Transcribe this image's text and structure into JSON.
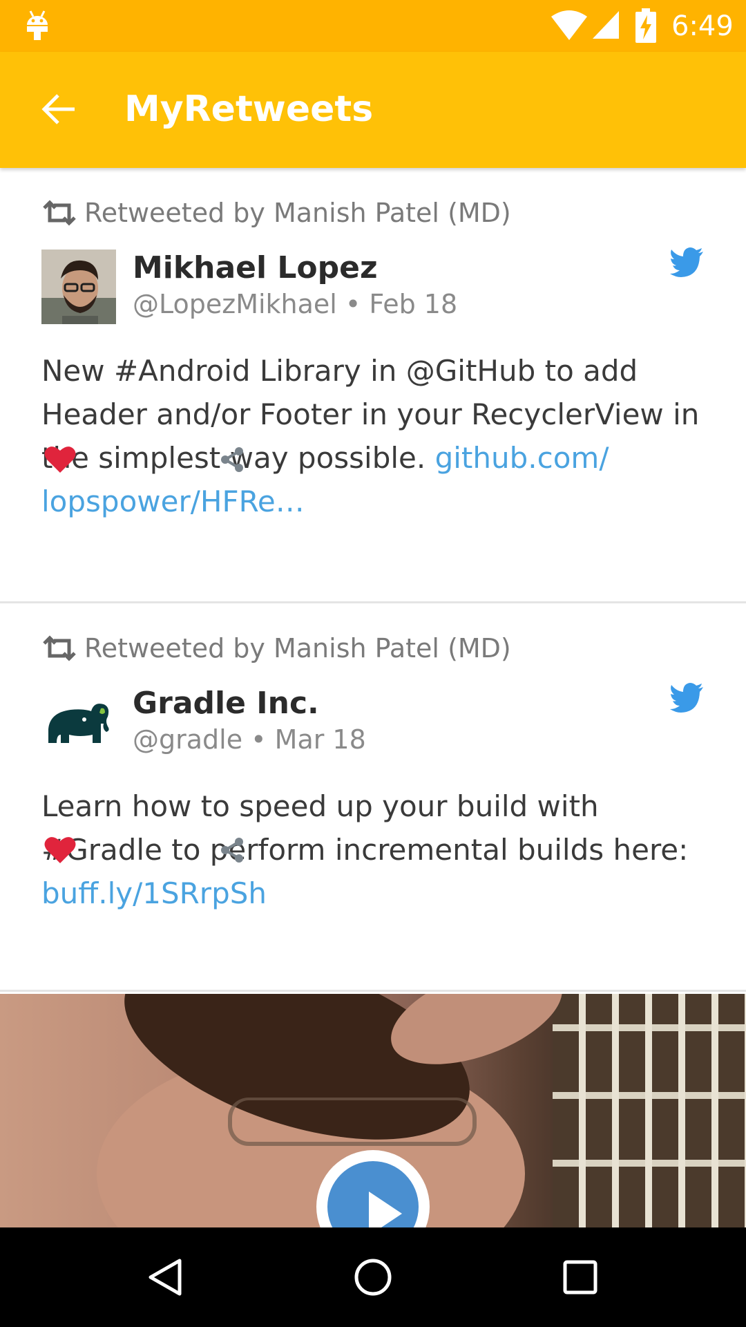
{
  "status_bar": {
    "time": "6:49",
    "icons": [
      "android-debug-icon",
      "wifi-icon",
      "cell-signal-icon",
      "battery-charging-icon"
    ]
  },
  "toolbar": {
    "title": "MyRetweets",
    "back_icon": "arrow-back-icon"
  },
  "tweets": [
    {
      "retweeted_by": "Retweeted by Manish Patel (MD)",
      "author_name": "Mikhael Lopez",
      "meta": "@LopezMikhael • Feb 18",
      "text_plain": "New #Android Library in @GitHub to add Header and/or Footer in your RecyclerView in the simplest way possible. ",
      "text_link": "github.com/ lopspower/HFRe…"
    },
    {
      "retweeted_by": "Retweeted by Manish Patel (MD)",
      "author_name": "Gradle Inc.",
      "meta": "@gradle • Mar 18",
      "text_plain": "Learn how to speed up your build with #Gradle to perform incremental builds here: ",
      "text_link": "buff.ly/1SRrpSh"
    }
  ],
  "colors": {
    "status_bar": "#FFB300",
    "toolbar": "#FFC107",
    "link": "#4aa3e0",
    "heart": "#e0243c",
    "twitter_blue": "#3a9ae8"
  },
  "nav_bar": {
    "buttons": [
      "back-triangle-icon",
      "home-circle-icon",
      "recents-square-icon"
    ]
  }
}
